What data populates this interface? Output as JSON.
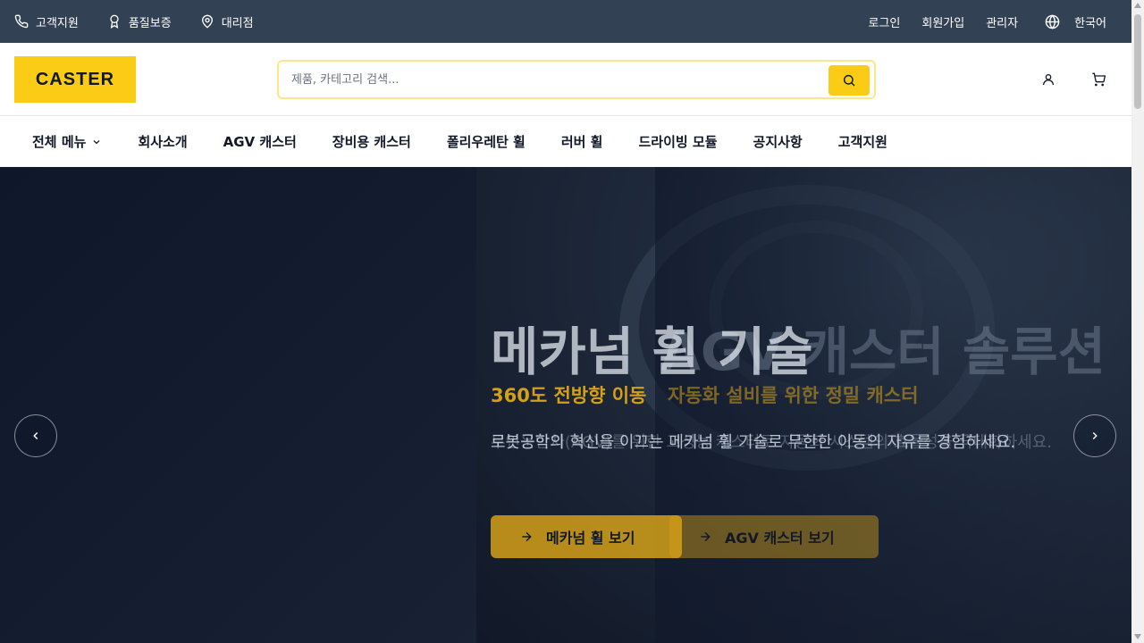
{
  "topbar": {
    "left_items": [
      {
        "label": "고객지원",
        "icon": "phone-icon"
      },
      {
        "label": "품질보증",
        "icon": "award-icon"
      },
      {
        "label": "대리점",
        "icon": "map-pin-icon"
      }
    ],
    "login": "로그인",
    "signup": "회원가입",
    "admin": "관리자",
    "language": "한국어"
  },
  "header": {
    "logo": "CASTER",
    "search_placeholder": "제품, 카테고리 검색..."
  },
  "nav": {
    "all_menu": "전체 메뉴",
    "items": [
      "회사소개",
      "AGV 캐스터",
      "장비용 캐스터",
      "폴리우레탄 휠",
      "러버 휠",
      "드라이빙 모듈",
      "공지사항",
      "고객지원"
    ]
  },
  "hero": {
    "slide_a": {
      "title": "메카넘 휠 기술",
      "subtitle": "360도 전방향 이동",
      "description": "로봇공학의 혁신을 이끄는 메카넘 휠 기술로 무한한 이동의 자유를 경험하세요.",
      "button": "메카넘 휠 보기"
    },
    "slide_b": {
      "title": "AGV 캐스터 솔루션",
      "subtitle": "자동화 설비를 위한 정밀 캐스터",
      "description": "무인운반차(AGV)를 위한 고성능 캐스터로 자동화 시스템의 효율성을 극대화하세요.",
      "button": "AGV 캐스터 보기"
    }
  },
  "colors": {
    "accent": "#facc15",
    "topbar_bg": "#334155",
    "hero_bg": "#0f172a"
  }
}
